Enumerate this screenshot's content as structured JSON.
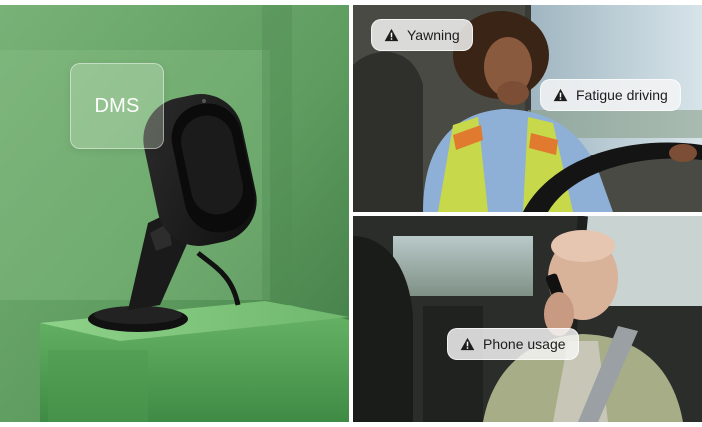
{
  "panels": {
    "device": {
      "card_label": "DMS"
    },
    "yawning": {
      "alert_label": "Yawning",
      "alert_icon": "warning-icon"
    },
    "fatigue": {
      "alert_label": "Fatigue driving",
      "alert_icon": "warning-icon"
    },
    "phone": {
      "alert_label": "Phone usage",
      "alert_icon": "warning-icon"
    }
  },
  "colors": {
    "scene_green": "#5fa062",
    "alert_bg": "#f2f2f2",
    "alert_text": "#1c1c1c",
    "card_text": "#ffffff"
  }
}
